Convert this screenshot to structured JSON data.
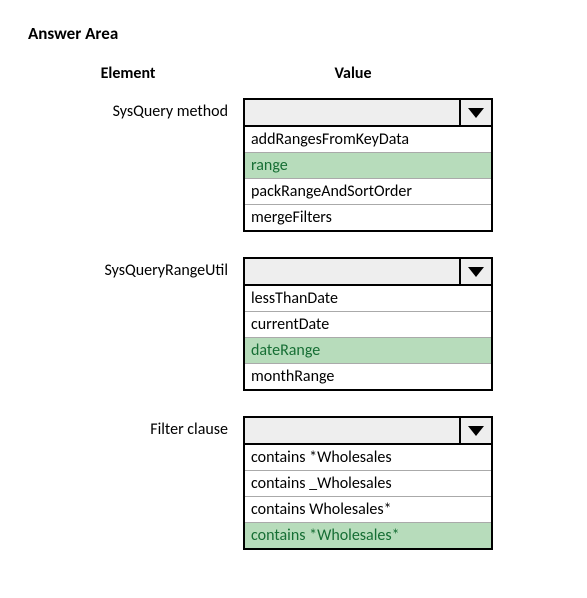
{
  "title": "Answer Area",
  "headers": {
    "element": "Element",
    "value": "Value"
  },
  "rows": [
    {
      "label": "SysQuery method",
      "options": [
        "addRangesFromKeyData",
        "range",
        "packRangeAndSortOrder",
        "mergeFilters"
      ],
      "highlight_index": 1
    },
    {
      "label": "SysQueryRangeUtil",
      "options": [
        "lessThanDate",
        "currentDate",
        "dateRange",
        "monthRange"
      ],
      "highlight_index": 2
    },
    {
      "label": "Filter clause",
      "options": [
        "contains *Wholesales",
        "contains _Wholesales",
        "contains Wholesales*",
        "contains *Wholesales*"
      ],
      "highlight_index": 3
    }
  ]
}
